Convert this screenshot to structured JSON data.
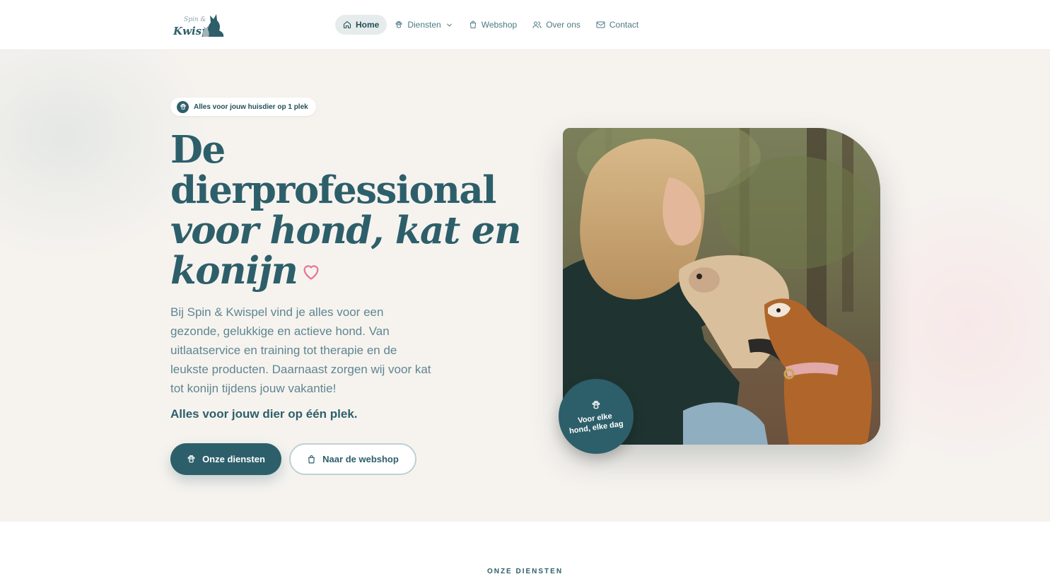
{
  "brand": {
    "logo_top": "Spin &",
    "logo_bottom": "Kwispel"
  },
  "nav": {
    "items": [
      {
        "label": "Home",
        "icon": "home-icon",
        "active": true
      },
      {
        "label": "Diensten",
        "icon": "paw-icon",
        "dropdown": true
      },
      {
        "label": "Webshop",
        "icon": "shopping-bag-icon"
      },
      {
        "label": "Over ons",
        "icon": "users-icon"
      },
      {
        "label": "Contact",
        "icon": "mail-icon"
      }
    ]
  },
  "hero": {
    "pill_text": "Alles voor jouw huisdier op 1 plek",
    "headline": {
      "line1": "De",
      "line2": "dierprofessional",
      "line3": "voor hond, kat en",
      "line4": "konijn"
    },
    "description": "Bij Spin & Kwispel vind je alles voor een gezonde, gelukkige en actieve hond. Van uitlaatservice en training tot therapie en de leukste producten. Daarnaast zorgen wij voor kat tot konijn tijdens jouw vakantie!",
    "strong_line": "Alles voor jouw dier op één plek.",
    "primary_button": "Onze diensten",
    "secondary_button": "Naar de webshop",
    "badge_line1": "Voor elke",
    "badge_line2": "hond, elke dag"
  },
  "services": {
    "section_label": "ONZE DIENSTEN"
  },
  "colors": {
    "primary": "#2d5f6a",
    "hero_background": "#f6f3ef",
    "heart": "#e57a92"
  }
}
